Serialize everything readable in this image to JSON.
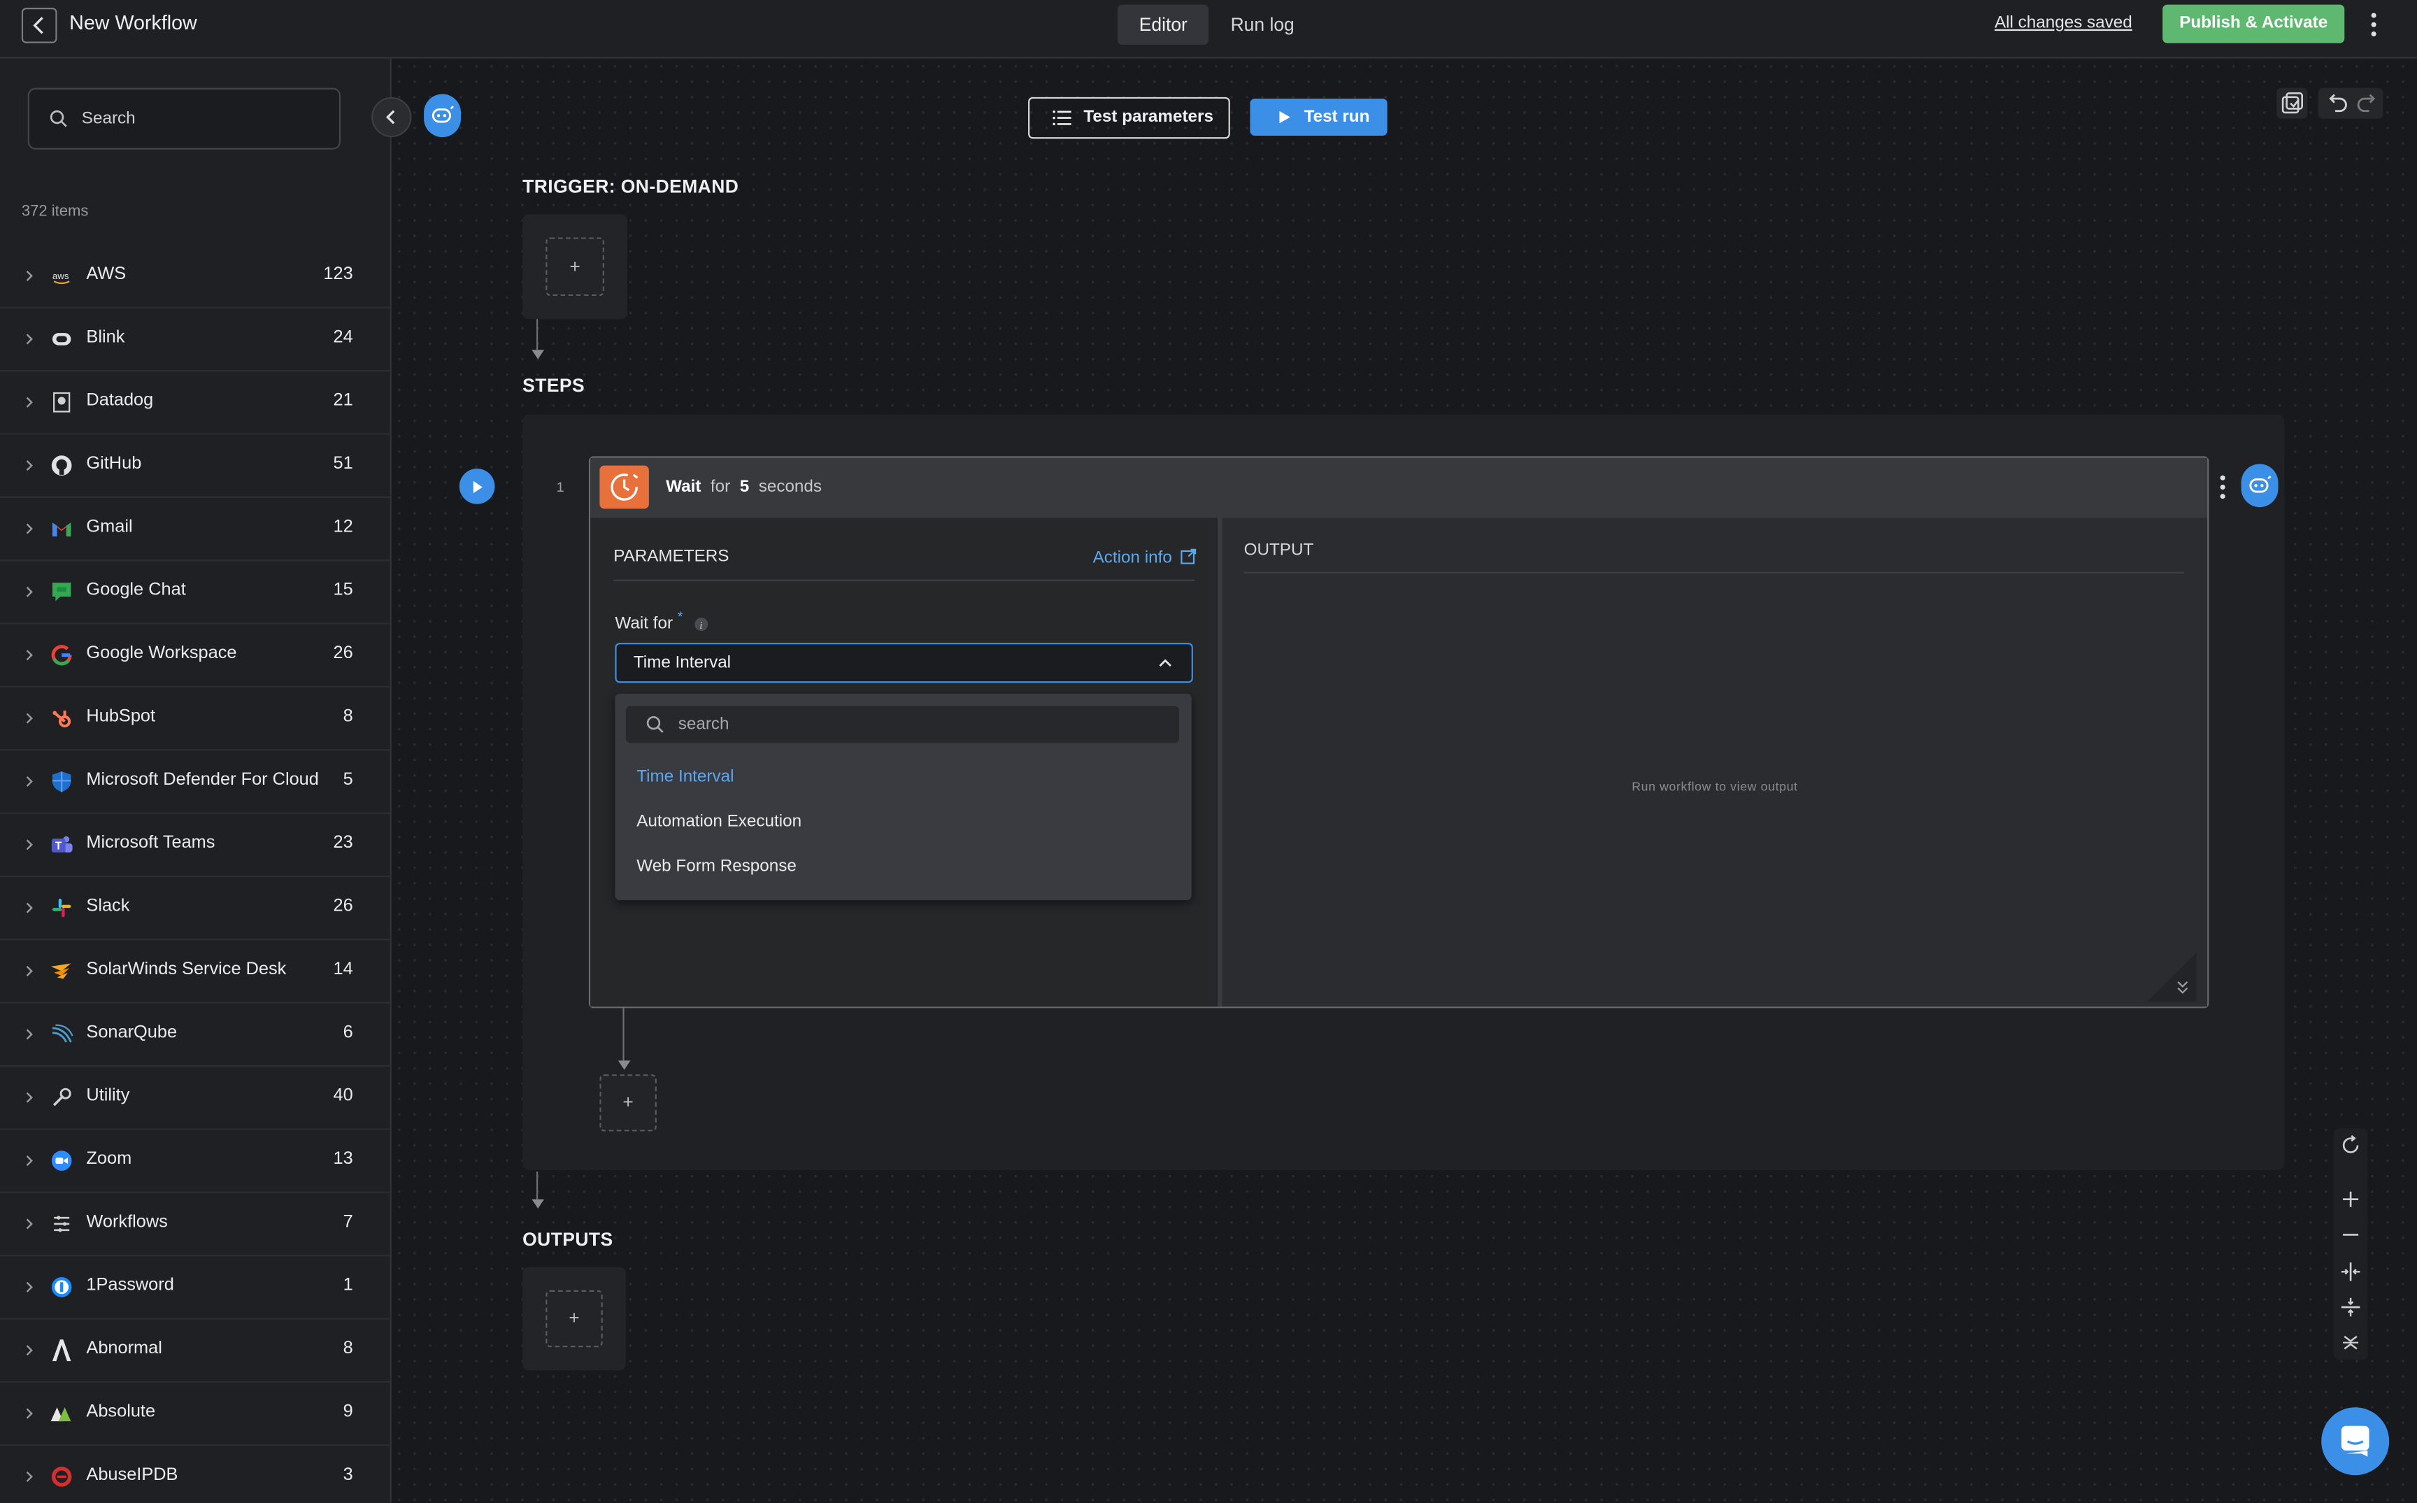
{
  "header": {
    "title": "New Workflow",
    "tabs": [
      {
        "label": "Editor",
        "active": true
      },
      {
        "label": "Run log",
        "active": false
      }
    ],
    "saved_status": "All changes saved",
    "publish_label": "Publish & Activate"
  },
  "sidebar": {
    "search_placeholder": "Search",
    "items_count": "372 items",
    "items": [
      {
        "label": "AWS",
        "count": "123",
        "icon": "aws-icon"
      },
      {
        "label": "Blink",
        "count": "24",
        "icon": "blink-icon"
      },
      {
        "label": "Datadog",
        "count": "21",
        "icon": "datadog-icon"
      },
      {
        "label": "GitHub",
        "count": "51",
        "icon": "github-icon"
      },
      {
        "label": "Gmail",
        "count": "12",
        "icon": "gmail-icon"
      },
      {
        "label": "Google Chat",
        "count": "15",
        "icon": "google-chat-icon"
      },
      {
        "label": "Google Workspace",
        "count": "26",
        "icon": "google-icon"
      },
      {
        "label": "HubSpot",
        "count": "8",
        "icon": "hubspot-icon"
      },
      {
        "label": "Microsoft Defender For Cloud",
        "count": "5",
        "icon": "defender-shield-icon"
      },
      {
        "label": "Microsoft Teams",
        "count": "23",
        "icon": "teams-icon"
      },
      {
        "label": "Slack",
        "count": "26",
        "icon": "slack-icon"
      },
      {
        "label": "SolarWinds Service Desk",
        "count": "14",
        "icon": "solarwinds-icon"
      },
      {
        "label": "SonarQube",
        "count": "6",
        "icon": "sonarqube-icon"
      },
      {
        "label": "Utility",
        "count": "40",
        "icon": "wrench-icon"
      },
      {
        "label": "Zoom",
        "count": "13",
        "icon": "zoom-icon"
      },
      {
        "label": "Workflows",
        "count": "7",
        "icon": "workflows-icon"
      },
      {
        "label": "1Password",
        "count": "1",
        "icon": "1password-icon"
      },
      {
        "label": "Abnormal",
        "count": "8",
        "icon": "abnormal-icon"
      },
      {
        "label": "Absolute",
        "count": "9",
        "icon": "absolute-icon"
      },
      {
        "label": "AbuseIPDB",
        "count": "3",
        "icon": "abuseipdb-icon"
      }
    ]
  },
  "toolbar": {
    "test_parameters_label": "Test parameters",
    "test_run_label": "Test run"
  },
  "canvas": {
    "trigger_title": "TRIGGER: ON-DEMAND",
    "steps_title": "STEPS",
    "outputs_title": "OUTPUTS",
    "add_symbol": "+"
  },
  "step": {
    "number": "1",
    "title_action": "Wait",
    "title_for": "for",
    "title_value": "5",
    "title_unit": "seconds",
    "params_heading": "PARAMETERS",
    "action_info_label": "Action info",
    "wait_for_label": "Wait for",
    "required_mark": "*",
    "dropdown_value": "Time Interval",
    "menu_search_placeholder": "search",
    "options": [
      "Time Interval",
      "Automation Execution",
      "Web Form Response"
    ],
    "output_heading": "OUTPUT",
    "output_placeholder": "Run workflow to view output"
  },
  "colors": {
    "accent": "#3b8fe6",
    "publish": "#5fb870",
    "step_icon": "#e8703a"
  }
}
